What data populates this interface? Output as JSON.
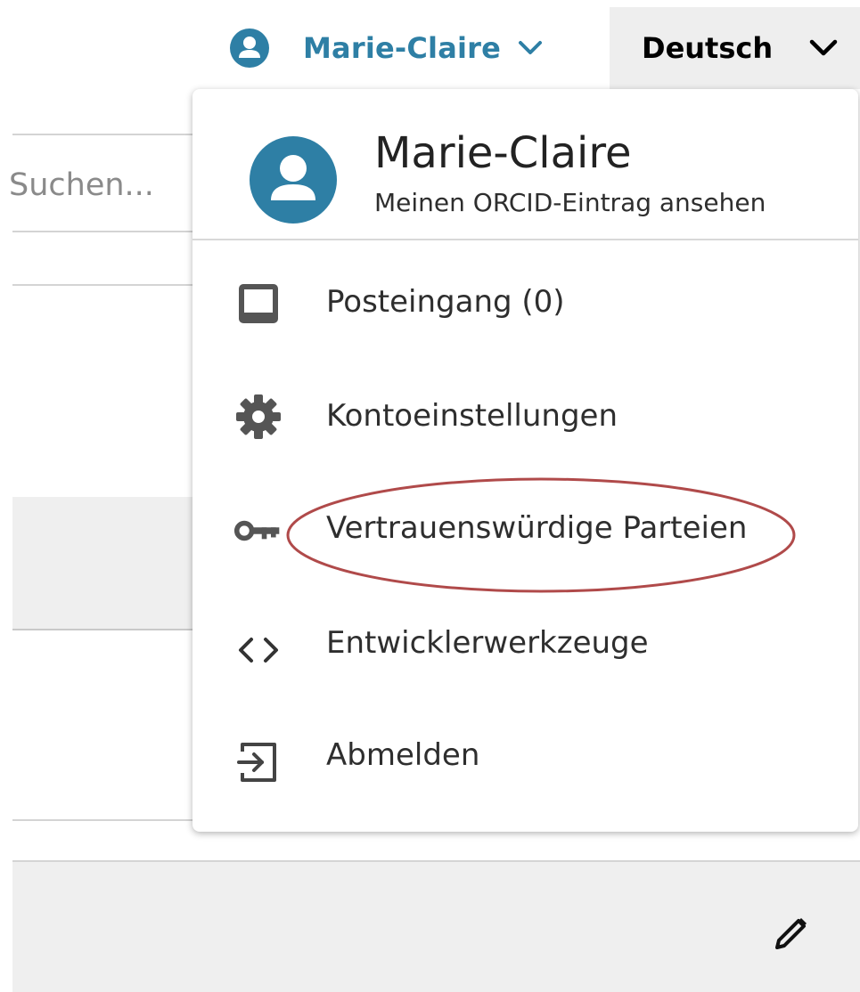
{
  "colors": {
    "accent": "#2e7fa5",
    "icon_gray": "#555555",
    "annotation_red": "#b04a4a"
  },
  "topbar": {
    "user_name": "Marie-Claire",
    "user_icon": "user-circle-icon",
    "user_chevron_icon": "chevron-down-icon",
    "language": "Deutsch",
    "language_chevron_icon": "chevron-down-icon"
  },
  "search": {
    "placeholder": "Suchen..."
  },
  "dropdown": {
    "name": "Marie-Claire",
    "profile_link": "Meinen ORCID-Eintrag ansehen",
    "items": [
      {
        "label": "Posteingang (0)",
        "icon": "inbox-icon"
      },
      {
        "label": "Kontoeinstellungen",
        "icon": "gear-icon"
      },
      {
        "label": "Vertrauenswürdige Parteien",
        "icon": "key-icon",
        "highlighted": true
      },
      {
        "label": "Entwicklerwerkzeuge",
        "icon": "code-icon"
      },
      {
        "label": "Abmelden",
        "icon": "sign-out-icon"
      }
    ]
  },
  "edit_icon": "pencil-icon"
}
